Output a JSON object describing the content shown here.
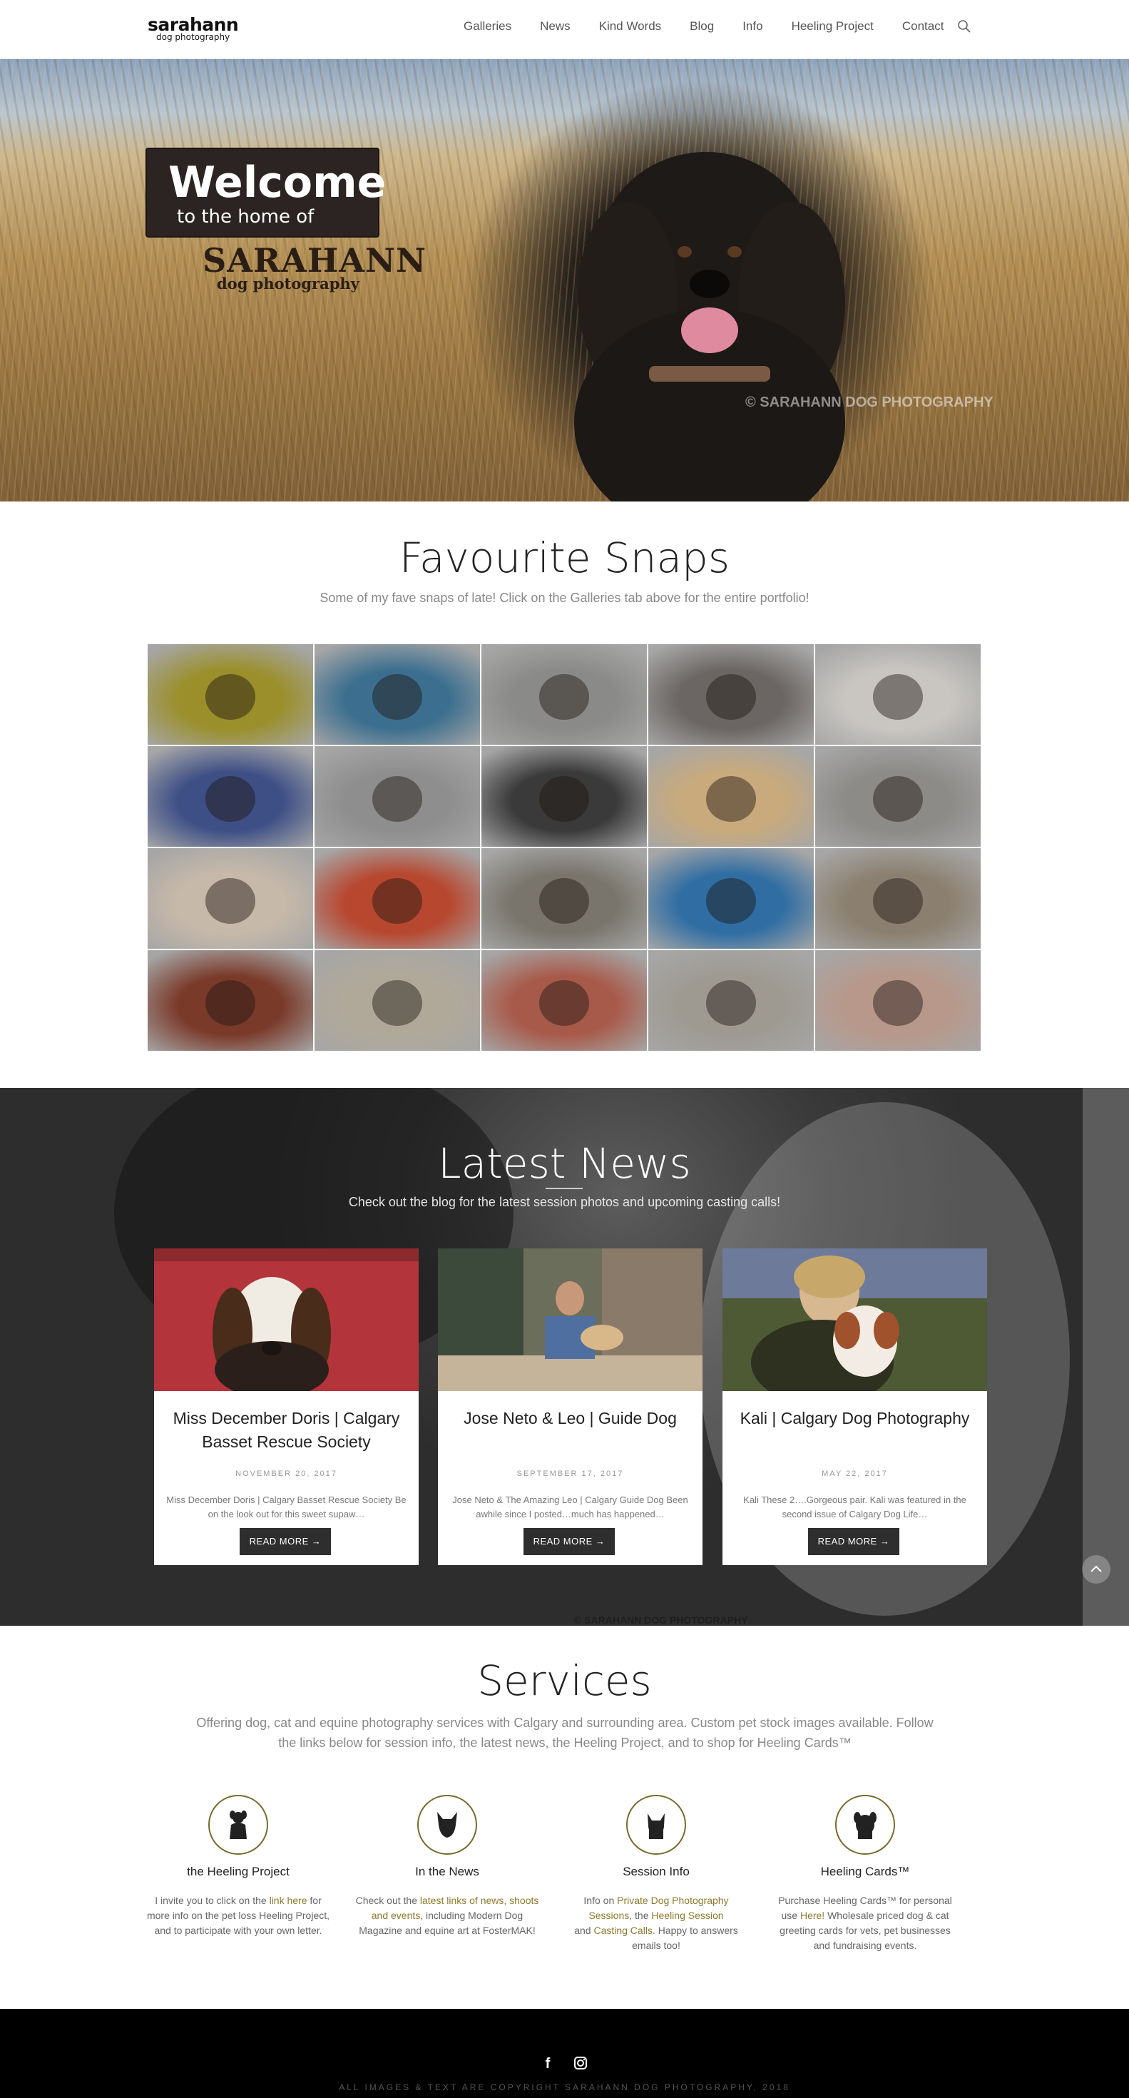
{
  "header": {
    "logo_main": "sarahann",
    "logo_sub": "dog photography",
    "nav": [
      "Galleries",
      "News",
      "Kind Words",
      "Blog",
      "Info",
      "Heeling Project",
      "Contact"
    ],
    "search_icon": "search-icon"
  },
  "hero": {
    "welcome": "Welcome",
    "welcome_sub": "to the home of",
    "brand": "SARAHANN",
    "brand_sub": "dog photography",
    "watermark": "© SARAHANN DOG PHOTOGRAPHY"
  },
  "snaps": {
    "title": "Favourite Snaps",
    "subtitle": "Some of my fave snaps of late! Click on the Galleries tab above for the entire portfolio!",
    "thumb_colors": [
      "#9a8f2a",
      "#3c6f8f",
      "#8a8a88",
      "#6b6663",
      "#c9c6c2",
      "#3e4f86",
      "#8e8e8e",
      "#3a3a3a",
      "#c8aa7d",
      "#8d8b88",
      "#c7b9aa",
      "#b8472f",
      "#79756c",
      "#2f6da3",
      "#8b8070",
      "#7a3a2a",
      "#b0a99a",
      "#a85a4a",
      "#9e9a92",
      "#b8988a"
    ]
  },
  "news": {
    "title": "Latest News",
    "subtitle": "Check out the blog for the latest session photos and upcoming casting calls!",
    "watermark": "© SARAHANN DOG PHOTOGRAPHY",
    "posts": [
      {
        "title": "Miss December Doris | Calgary Basset Rescue Society",
        "date": "NOVEMBER 20, 2017",
        "excerpt": "Miss December Doris | Calgary Basset Rescue Society Be on the look out for this sweet supaw…",
        "button": "READ MORE →",
        "img_color": "#b3343a"
      },
      {
        "title": "Jose Neto & Leo | Guide Dog",
        "date": "SEPTEMBER 17, 2017",
        "excerpt": "Jose Neto & The Amazing Leo | Calgary Guide Dog Been awhile since I posted…much has happened…",
        "button": "READ MORE →",
        "img_color": "#6b7356"
      },
      {
        "title": "Kali | Calgary Dog Photography",
        "date": "MAY 22, 2017",
        "excerpt": "Kali   These 2….Gorgeous pair. Kali was featured in the second issue of Calgary Dog Life…",
        "button": "READ MORE →",
        "img_color": "#5e6a44"
      }
    ]
  },
  "services": {
    "title": "Services",
    "subtitle": "Offering dog, cat and equine photography services with Calgary and surrounding area. Custom pet stock images available. Follow the links below for session info, the latest news, the Heeling Project, and to shop for Heeling Cards™",
    "items": [
      {
        "title": "the Heeling Project",
        "pre": "I invite you to click on the ",
        "link": "link here",
        "post": " for more info on the pet loss Heeling Project, and to participate with your own letter.",
        "icon": "dog-sitting-icon"
      },
      {
        "title": "In the News",
        "pre": "Check out the ",
        "link": "latest links of news, shoots and events",
        "post": ", including Modern Dog Magazine and equine art at FosterMAK!",
        "icon": "dog-head-icon"
      },
      {
        "title": "Session Info",
        "pre": "Info on ",
        "link": "Private Dog Photography Sessions",
        "mid": ", the ",
        "link2": "Heeling Session",
        "mid2": " and ",
        "link3": "Casting Calls",
        "post": ". Happy to answers emails too!",
        "icon": "dog-face-icon"
      },
      {
        "title": "Heeling Cards™",
        "pre": "Purchase Heeling Cards™ for personal use ",
        "link": "Here!",
        "post": " Wholesale priced dog & cat greeting cards for vets, pet businesses and fundraising events.",
        "icon": "dog-portrait-icon"
      }
    ]
  },
  "footer": {
    "facebook": "f",
    "instagram_icon": "instagram-icon",
    "copyright": "ALL IMAGES & TEXT ARE COPYRIGHT SARAHANN DOG PHOTOGRAPHY, 2018"
  },
  "colors": {
    "accent": "#8c7b2e",
    "footer_bg": "#000000",
    "button_bg": "#2e2e2e"
  }
}
